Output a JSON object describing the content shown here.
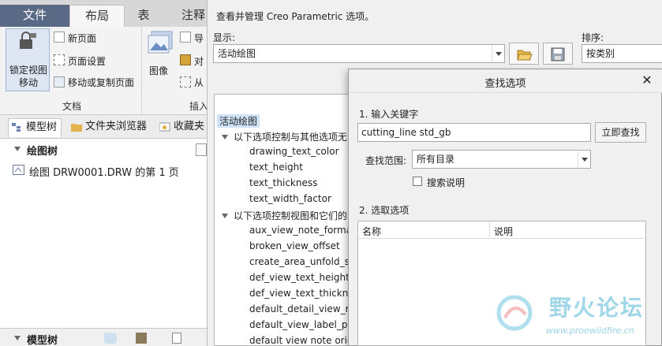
{
  "ribbon": {
    "tabs": [
      "文件",
      "布局",
      "表",
      "注释"
    ],
    "active_tab": "布局",
    "lock_view_move": "锁定视图\n移动",
    "new_page": "新页面",
    "page_setup": "页面设置",
    "move_copy_page": "移动或复制页面",
    "image": "图像",
    "import_trunc": "导",
    "align_trunc": "对",
    "from_trunc": "从",
    "group_document": "文档",
    "group_insert_trunc": "插入"
  },
  "left_panel": {
    "tabs": [
      "模型树",
      "文件夹浏览器",
      "收藏夹"
    ],
    "drawing_tree_header": "绘图树",
    "drawing_item": "绘图 DRW0001.DRW 的第 1 页",
    "bottom_header": "模型树"
  },
  "options_dialog": {
    "description": "查看并管理 Creo Parametric 选项。",
    "show_label": "显示:",
    "show_value": "活动绘图",
    "sort_label": "排序:",
    "sort_value": "按类别",
    "tree": {
      "root": "活动绘图",
      "group1": "以下选项控制与其他选项无",
      "group1_items": [
        "drawing_text_color",
        "text_height",
        "text_thickness",
        "text_width_factor"
      ],
      "group2": "以下选项控制视图和它们的",
      "group2_items": [
        "aux_view_note_format",
        "broken_view_offset",
        "create_area_unfold_se",
        "def_view_text_height",
        "def_view_text_thicknes",
        "default_detail_view_na",
        "default_view_label_pla",
        "default view note orie"
      ]
    }
  },
  "find_dialog": {
    "title": "查找选项",
    "step1": "1. 输入关键字",
    "keyword": "cutting_line std_gb",
    "find_now": "立即查找",
    "scope_label": "查找范围:",
    "scope_value": "所有目录",
    "search_desc": "搜索说明",
    "step2": "2. 选取选项",
    "col_name": "名称",
    "col_desc": "说明"
  },
  "watermark": {
    "title": "野火论坛",
    "url": "www.proewildfire.cn"
  },
  "colors": {
    "accent_dark_tab": "#5a6a86",
    "selection": "#cfe3f7",
    "watermark": "#8fd1e6"
  }
}
